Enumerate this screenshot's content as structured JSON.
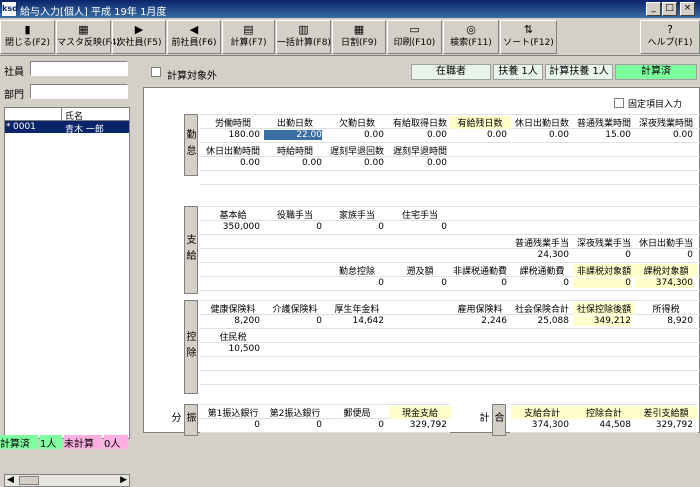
{
  "window": {
    "app_icon": "ksd",
    "title": "給与入力[個人] 平成 19年 1月度",
    "min": "_",
    "max": "□",
    "close": "×"
  },
  "toolbar": [
    {
      "label": "閉じる(F2)",
      "icon": "door-icon",
      "glyph": "▮"
    },
    {
      "label": "マスタ反映(F4)",
      "icon": "master-icon",
      "glyph": "▦"
    },
    {
      "label": "次社員(F5)",
      "icon": "next-icon",
      "glyph": "▶"
    },
    {
      "label": "前社員(F6)",
      "icon": "prev-icon",
      "glyph": "◀"
    },
    {
      "label": "計算(F7)",
      "icon": "calculator-icon",
      "glyph": "▤"
    },
    {
      "label": "一括計算(F8)",
      "icon": "batch-calc-icon",
      "glyph": "▥"
    },
    {
      "label": "日割(F9)",
      "icon": "calendar-icon",
      "glyph": "▦"
    },
    {
      "label": "印刷(F10)",
      "icon": "printer-icon",
      "glyph": "▭"
    },
    {
      "label": "検索(F11)",
      "icon": "search-icon",
      "glyph": "◎"
    },
    {
      "label": "ソート(F12)",
      "icon": "sort-icon",
      "glyph": "⇅"
    },
    {
      "label": "ヘルプ(F1)",
      "icon": "help-icon",
      "glyph": "?"
    }
  ],
  "left": {
    "employee_label": "社員",
    "dept_label": "部門",
    "col_name": "氏名",
    "row": {
      "mark": "*",
      "code": "0001",
      "name": "青木 一郎"
    },
    "status_done": "計算済",
    "status_done_count": "1人",
    "status_undone": "未計算",
    "status_undone_count": "0人"
  },
  "top": {
    "exclude_label": "計算対象外",
    "status_enrolled": "在職者",
    "dependents": "扶養 1人",
    "calc_dependents": "計算扶養 1人",
    "calc_state": "計算済"
  },
  "fixed_label": "固定項目入力",
  "kintai": {
    "section": "勤怠",
    "h1": [
      "労働時間",
      "出勤日数",
      "欠勤日数",
      "有給取得日数",
      "有給残日数",
      "休日出勤日数",
      "普通残業時間",
      "深夜残業時間"
    ],
    "v1": [
      "180.00",
      "22.00",
      "0.00",
      "0.00",
      "0.00",
      "0.00",
      "15.00",
      "0.00"
    ],
    "h2": [
      "休日出勤時間",
      "時給時間",
      "遅刻早退回数",
      "遅刻早退時間"
    ],
    "v2": [
      "0.00",
      "0.00",
      "0.00",
      "0.00"
    ]
  },
  "shikyu": {
    "section": "支給",
    "h1": [
      "基本給",
      "役職手当",
      "家族手当",
      "住宅手当"
    ],
    "v1": [
      "350,000",
      "0",
      "0",
      "0"
    ],
    "h2": [
      "普通残業手当",
      "深夜残業手当",
      "休日出勤手当"
    ],
    "v2": [
      "24,300",
      "0",
      "0"
    ],
    "h3": [
      "勤怠控除",
      "遡及額",
      "非課税通勤費",
      "課税通勤費",
      "非課税対象額",
      "課税対象額"
    ],
    "v3": [
      "0",
      "0",
      "0",
      "0",
      "0",
      "374,300"
    ]
  },
  "kojo": {
    "section": "控除",
    "h1": [
      "健康保険料",
      "介護保険料",
      "厚生年金料",
      "雇用保険料",
      "社会保険合計",
      "社保控除後額",
      "所得税"
    ],
    "v1": [
      "8,200",
      "0",
      "14,642",
      "2,246",
      "25,088",
      "349,212",
      "8,920"
    ],
    "h2": [
      "住民税"
    ],
    "v2": [
      "10,500"
    ]
  },
  "furikomi": {
    "section": "振分",
    "h": [
      "第1振込銀行",
      "第2振込銀行",
      "郵便局",
      "現金支給"
    ],
    "v": [
      "0",
      "0",
      "0",
      "329,792"
    ]
  },
  "gokei": {
    "section": "合計",
    "h": [
      "支給合計",
      "控除合計",
      "差引支給額"
    ],
    "v": [
      "374,300",
      "44,508",
      "329,792"
    ]
  }
}
